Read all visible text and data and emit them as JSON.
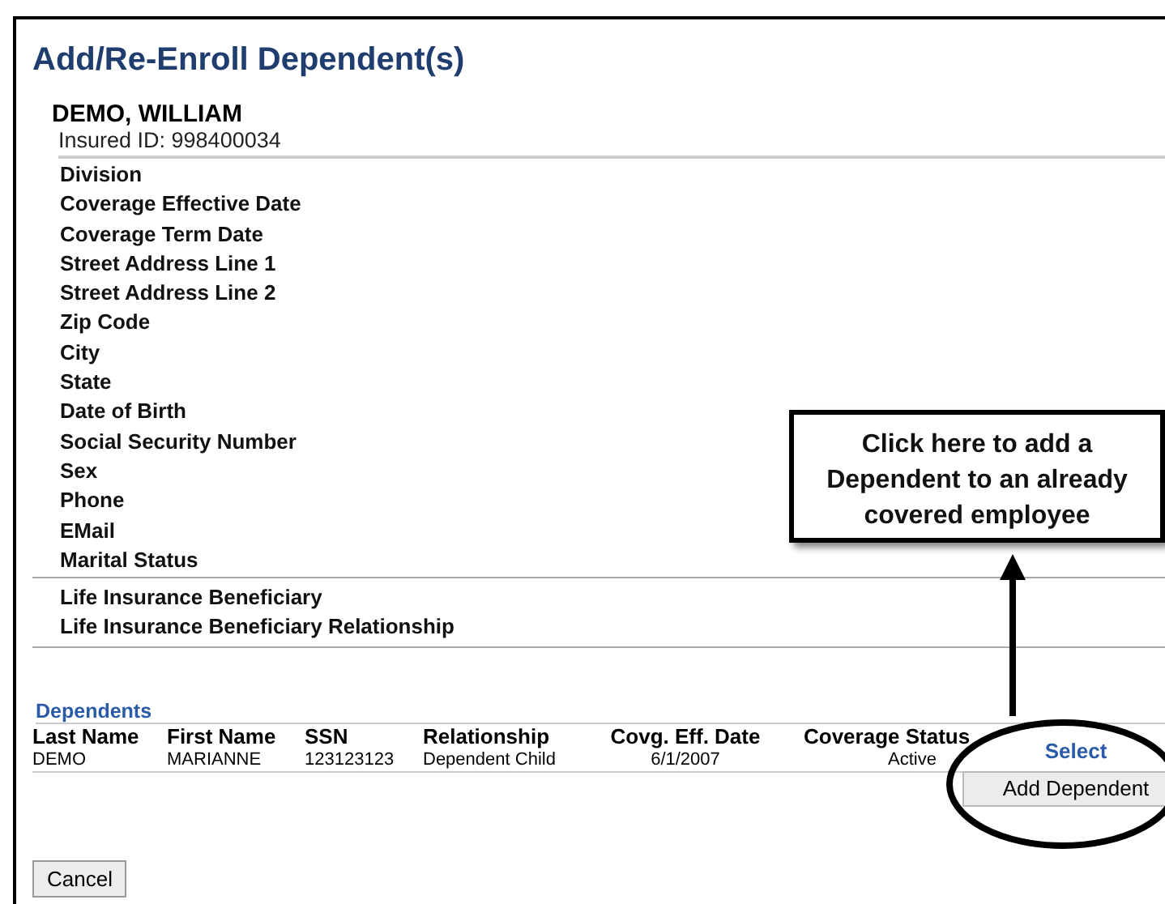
{
  "page": {
    "title": "Add/Re-Enroll Dependent(s)"
  },
  "insured": {
    "name": "DEMO, WILLIAM",
    "id_line": "Insured ID: 998400034"
  },
  "fields": [
    "Division",
    "Coverage Effective Date",
    "Coverage Term Date",
    "Street Address Line 1",
    "Street Address Line 2",
    "Zip Code",
    "City",
    "State",
    "Date of Birth",
    "Social Security Number",
    "Sex",
    "Phone",
    "EMail",
    "Marital Status"
  ],
  "beneficiary_fields": [
    "Life Insurance Beneficiary",
    "Life Insurance Beneficiary Relationship"
  ],
  "dependents": {
    "title": "Dependents",
    "columns": [
      "Last Name",
      "First Name",
      "SSN",
      "Relationship",
      "Covg. Eff. Date",
      "Coverage Status",
      "Select"
    ],
    "rows": [
      [
        "DEMO",
        "MARIANNE",
        "123123123",
        "Dependent Child",
        "6/1/2007",
        "Active"
      ]
    ],
    "add_button": "Add Dependent"
  },
  "buttons": [
    "Cancel"
  ],
  "callout": {
    "text": "Click here to add a Dependent to an already covered employee"
  }
}
